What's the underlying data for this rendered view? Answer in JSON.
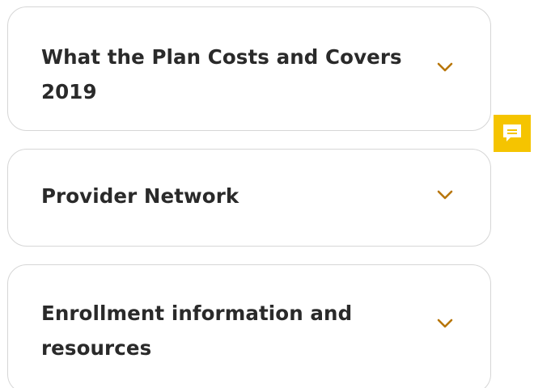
{
  "accordions": [
    {
      "title": "What the Plan Costs and Covers 2019",
      "expanded": false,
      "icon": "chevron-down-icon"
    },
    {
      "title": "Provider Network",
      "expanded": false,
      "icon": "chevron-down-icon"
    },
    {
      "title": "Enrollment information and resources",
      "expanded": false,
      "icon": "chevron-down-icon"
    }
  ],
  "feedback": {
    "icon": "feedback-icon"
  },
  "colors": {
    "accent_chevron": "#b8760a",
    "feedback_bg": "#f5c400",
    "border": "#d6d6d6",
    "text": "#2a2a2a"
  }
}
